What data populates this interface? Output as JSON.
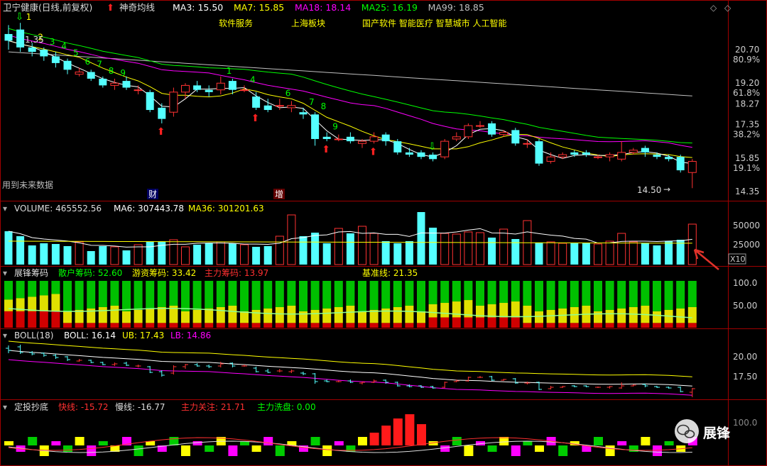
{
  "header": {
    "title": "卫宁健康(日线,前复权)",
    "indicator_name": "神奇均线",
    "ma_items": [
      {
        "label": "MA3: 15.50",
        "color": "#ffffff"
      },
      {
        "label": "MA7: 15.85",
        "color": "#ffff00"
      },
      {
        "label": "MA18: 18.14",
        "color": "#ff00ff"
      },
      {
        "label": "MA25: 16.19",
        "color": "#00ff00"
      },
      {
        "label": "MA99: 18.85",
        "color": "#c0c0c0"
      }
    ],
    "concepts_1": [
      "软件服务",
      "上海板块"
    ],
    "concepts_2": "国产软件 智能医疗 智慧城市 人工智能"
  },
  "main_chart": {
    "right_axis": [
      {
        "label": "20.70",
        "pct": "80.9%"
      },
      {
        "label": "19.20",
        "pct": "61.8%"
      },
      {
        "label": "18.27",
        "pct": ""
      },
      {
        "label": "17.35",
        "pct": "38.2%"
      },
      {
        "label": "15.85",
        "pct": "19.1%"
      },
      {
        "label": "14.35",
        "pct": ""
      }
    ],
    "high_label": "1.35",
    "low_label": "14.50",
    "future_data_label": "用到未来数据",
    "marker_cai": "财",
    "marker_zeng": "增",
    "candles": [
      {
        "o": 21.4,
        "c": 21.1,
        "h": 21.8,
        "l": 20.7
      },
      {
        "o": 21.6,
        "c": 20.8,
        "h": 21.9,
        "l": 20.6
      },
      {
        "o": 20.8,
        "c": 20.6,
        "h": 21.0,
        "l": 20.4
      },
      {
        "o": 20.7,
        "c": 20.4,
        "h": 20.8,
        "l": 20.2
      },
      {
        "o": 20.4,
        "c": 20.1,
        "h": 20.6,
        "l": 19.9
      },
      {
        "o": 20.2,
        "c": 19.8,
        "h": 20.3,
        "l": 19.6
      },
      {
        "o": 19.6,
        "c": 19.7,
        "h": 19.9,
        "l": 19.5
      },
      {
        "o": 19.7,
        "c": 19.4,
        "h": 19.8,
        "l": 19.3
      },
      {
        "o": 19.4,
        "c": 19.1,
        "h": 19.5,
        "l": 19.0
      },
      {
        "o": 19.1,
        "c": 19.2,
        "h": 19.4,
        "l": 18.9
      },
      {
        "o": 19.3,
        "c": 19.0,
        "h": 19.5,
        "l": 18.9
      },
      {
        "o": 18.9,
        "c": 18.9,
        "h": 19.1,
        "l": 18.7
      },
      {
        "o": 18.8,
        "c": 18.0,
        "h": 18.9,
        "l": 17.9
      },
      {
        "o": 18.1,
        "c": 17.6,
        "h": 18.3,
        "l": 17.4
      },
      {
        "o": 17.9,
        "c": 18.8,
        "h": 19.0,
        "l": 17.7
      },
      {
        "o": 18.8,
        "c": 19.1,
        "h": 19.2,
        "l": 18.5
      },
      {
        "o": 19.1,
        "c": 18.9,
        "h": 19.3,
        "l": 18.8
      },
      {
        "o": 18.9,
        "c": 18.8,
        "h": 19.1,
        "l": 18.6
      },
      {
        "o": 18.9,
        "c": 19.2,
        "h": 19.5,
        "l": 18.7
      },
      {
        "o": 19.3,
        "c": 18.9,
        "h": 19.4,
        "l": 18.7
      },
      {
        "o": 18.9,
        "c": 18.9,
        "h": 19.1,
        "l": 18.8
      },
      {
        "o": 18.6,
        "c": 18.1,
        "h": 18.8,
        "l": 18.0
      },
      {
        "o": 18.2,
        "c": 18.0,
        "h": 18.5,
        "l": 17.9
      },
      {
        "o": 18.2,
        "c": 18.2,
        "h": 18.5,
        "l": 18.0
      },
      {
        "o": 18.1,
        "c": 18.2,
        "h": 18.4,
        "l": 17.9
      },
      {
        "o": 17.9,
        "c": 17.8,
        "h": 18.1,
        "l": 17.6
      },
      {
        "o": 17.8,
        "c": 16.7,
        "h": 17.9,
        "l": 16.4
      },
      {
        "o": 16.8,
        "c": 16.7,
        "h": 17.0,
        "l": 16.6
      },
      {
        "o": 16.7,
        "c": 16.7,
        "h": 16.9,
        "l": 16.6
      },
      {
        "o": 16.8,
        "c": 16.6,
        "h": 17.0,
        "l": 16.5
      },
      {
        "o": 16.5,
        "c": 16.6,
        "h": 16.7,
        "l": 16.3
      },
      {
        "o": 16.6,
        "c": 16.8,
        "h": 17.0,
        "l": 16.5
      },
      {
        "o": 16.9,
        "c": 16.6,
        "h": 17.0,
        "l": 16.4
      },
      {
        "o": 16.6,
        "c": 16.1,
        "h": 16.7,
        "l": 16.0
      },
      {
        "o": 16.1,
        "c": 16.0,
        "h": 16.3,
        "l": 15.9
      },
      {
        "o": 16.1,
        "c": 15.9,
        "h": 16.2,
        "l": 15.8
      },
      {
        "o": 16.0,
        "c": 15.8,
        "h": 16.1,
        "l": 15.7
      },
      {
        "o": 15.9,
        "c": 16.6,
        "h": 16.7,
        "l": 15.8
      },
      {
        "o": 16.7,
        "c": 16.8,
        "h": 17.0,
        "l": 16.6
      },
      {
        "o": 16.8,
        "c": 17.3,
        "h": 17.4,
        "l": 16.7
      },
      {
        "o": 17.3,
        "c": 17.3,
        "h": 17.5,
        "l": 17.2
      },
      {
        "o": 17.4,
        "c": 16.9,
        "h": 17.5,
        "l": 16.8
      },
      {
        "o": 16.9,
        "c": 17.0,
        "h": 17.1,
        "l": 16.8
      },
      {
        "o": 17.1,
        "c": 16.5,
        "h": 17.2,
        "l": 16.4
      },
      {
        "o": 16.5,
        "c": 16.5,
        "h": 16.7,
        "l": 16.3
      },
      {
        "o": 16.6,
        "c": 15.6,
        "h": 16.7,
        "l": 15.5
      },
      {
        "o": 15.7,
        "c": 15.9,
        "h": 16.1,
        "l": 15.6
      },
      {
        "o": 15.9,
        "c": 16.0,
        "h": 16.1,
        "l": 15.8
      },
      {
        "o": 16.1,
        "c": 16.0,
        "h": 16.2,
        "l": 15.9
      },
      {
        "o": 16.1,
        "c": 16.0,
        "h": 16.2,
        "l": 15.9
      },
      {
        "o": 15.9,
        "c": 15.9,
        "h": 16.0,
        "l": 15.8
      },
      {
        "o": 15.9,
        "c": 16.0,
        "h": 16.1,
        "l": 15.7
      },
      {
        "o": 15.8,
        "c": 16.1,
        "h": 16.6,
        "l": 15.7
      },
      {
        "o": 16.1,
        "c": 16.2,
        "h": 16.3,
        "l": 16.0
      },
      {
        "o": 16.3,
        "c": 16.1,
        "h": 16.4,
        "l": 15.9
      },
      {
        "o": 16.0,
        "c": 15.9,
        "h": 16.1,
        "l": 15.8
      },
      {
        "o": 15.9,
        "c": 15.8,
        "h": 16.0,
        "l": 15.7
      },
      {
        "o": 15.9,
        "c": 15.3,
        "h": 16.0,
        "l": 15.2
      },
      {
        "o": 15.2,
        "c": 15.7,
        "h": 15.8,
        "l": 14.5
      }
    ],
    "nine_labels": [
      {
        "i": 1,
        "t": "1",
        "c": "#ffff00"
      },
      {
        "i": 2,
        "t": "2",
        "c": "#ffff00"
      },
      {
        "i": 3,
        "t": "3",
        "c": "#00ff00"
      },
      {
        "i": 4,
        "t": "4",
        "c": "#00ff00"
      },
      {
        "i": 5,
        "t": "5",
        "c": "#00ff00"
      },
      {
        "i": 6,
        "t": "6",
        "c": "#00ff00"
      },
      {
        "i": 7,
        "t": "7",
        "c": "#00ff00"
      },
      {
        "i": 8,
        "t": "8",
        "c": "#00ff00"
      },
      {
        "i": 9,
        "t": "9",
        "c": "#00ff00"
      },
      {
        "i": 18,
        "t": "1",
        "c": "#00ff00"
      },
      {
        "i": 20,
        "t": "4",
        "c": "#00ff00"
      },
      {
        "i": 23,
        "t": "6",
        "c": "#00ff00"
      },
      {
        "i": 25,
        "t": "7",
        "c": "#00ff00"
      },
      {
        "i": 26,
        "t": "8",
        "c": "#00ff00"
      },
      {
        "i": 27,
        "t": "9",
        "c": "#00ff00"
      }
    ],
    "up_arrows": [
      13,
      21,
      27,
      31
    ],
    "down_arrows": [
      1,
      36
    ]
  },
  "volume": {
    "title": "VOLUME: 465552.56",
    "ma6": "MA6: 307443.78",
    "ma36": "MA36: 301201.63",
    "axis": [
      "50000",
      "25000"
    ],
    "multiplier": "X10",
    "values": [
      47,
      40,
      27,
      30,
      29,
      26,
      32,
      19,
      26,
      25,
      20,
      28,
      32,
      32,
      35,
      25,
      28,
      30,
      32,
      30,
      28,
      25,
      26,
      40,
      70,
      40,
      45,
      30,
      51,
      44,
      54,
      44,
      33,
      30,
      33,
      74,
      52,
      44,
      43,
      46,
      45,
      38,
      50,
      36,
      62,
      31,
      32,
      30,
      30,
      30,
      29,
      33,
      44,
      32,
      30,
      27,
      33,
      35,
      57
    ]
  },
  "chips": {
    "title": "展锋筹码",
    "retail": "散户筹码: 52.60",
    "hot": "游资筹码: 33.42",
    "main": "主力筹码: 13.97",
    "baseline": "基准线: 21.35",
    "axis": [
      "100.0",
      "50.00"
    ]
  },
  "boll": {
    "title": "BOLL(18)",
    "boll": "BOLL: 16.14",
    "ub": "UB: 17.43",
    "lb": "LB: 14.86",
    "axis": [
      "20.00",
      "17.50"
    ]
  },
  "dingtou": {
    "title": "定投抄底",
    "fast": "快线: -15.72",
    "slow": "慢线: -16.77",
    "main_focus": "主力关注: 21.71",
    "main_wash": "主力洗盘: 0.00",
    "axis": [
      "100.0"
    ]
  },
  "watermark": "展锋",
  "colors": {
    "up": "#ff3232",
    "down": "#54ffff",
    "ma3": "#ffffff",
    "ma7": "#ffff00",
    "ma18": "#ff00ff",
    "ma25": "#00ff00",
    "ma99": "#c0c0c0",
    "grid": "#800000"
  }
}
